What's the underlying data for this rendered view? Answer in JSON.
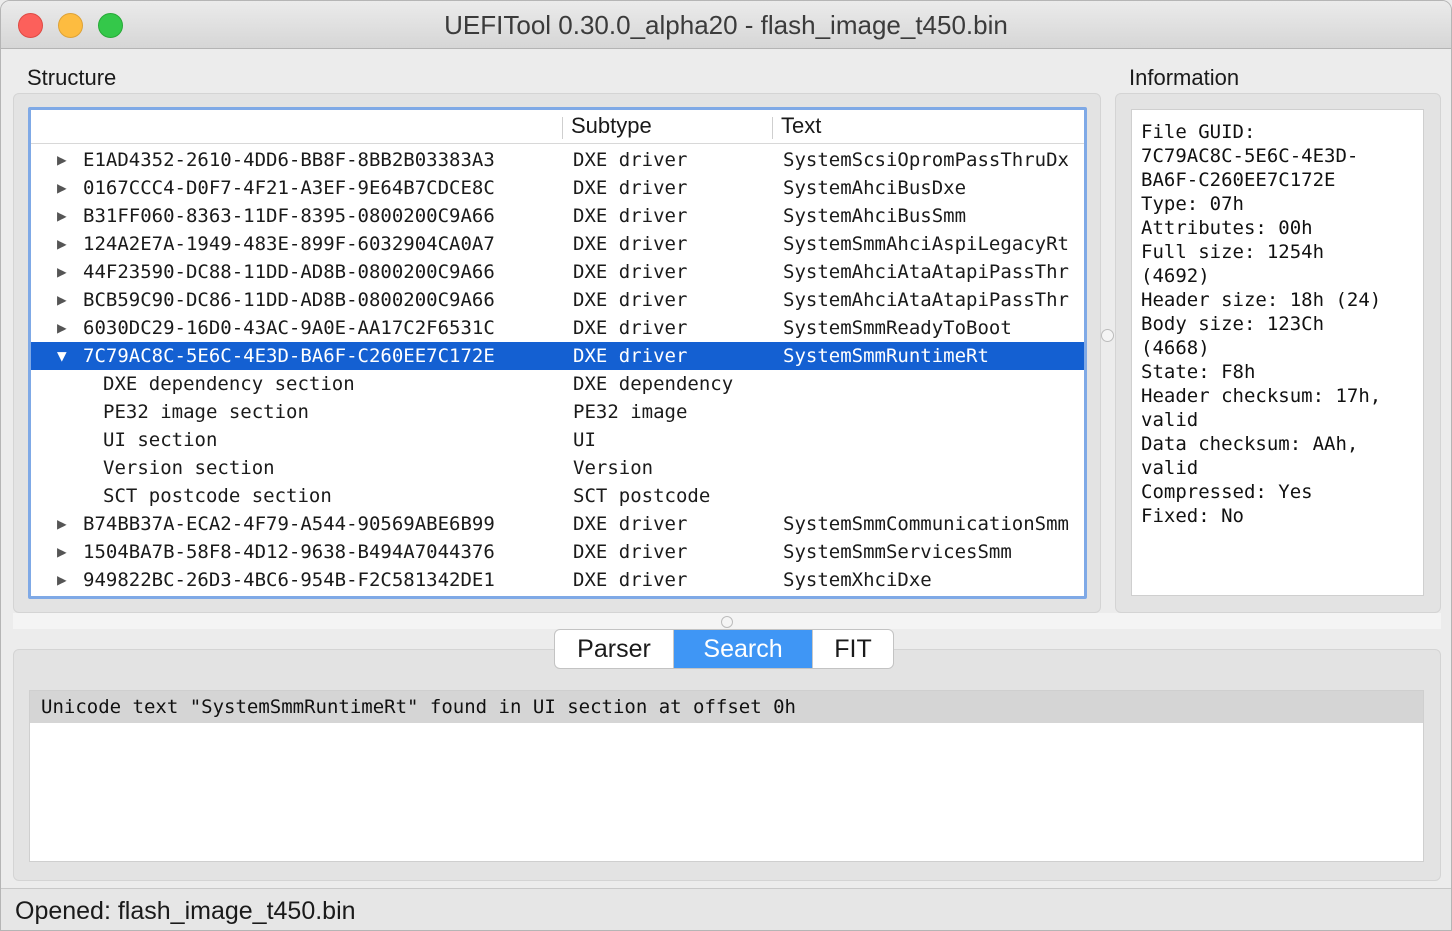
{
  "window": {
    "title": "UEFITool 0.30.0_alpha20 - flash_image_t450.bin"
  },
  "structure": {
    "label": "Structure",
    "columns": {
      "name": "",
      "subtype": "Subtype",
      "text": "Text"
    },
    "rows": [
      {
        "arrow": "▶",
        "name": "E1AD4352-2610-4DD6-BB8F-8BB2B03383A3",
        "subtype": "DXE driver",
        "text": "SystemScsiOpromPassThruDx"
      },
      {
        "arrow": "▶",
        "name": "0167CCC4-D0F7-4F21-A3EF-9E64B7CDCE8C",
        "subtype": "DXE driver",
        "text": "SystemAhciBusDxe"
      },
      {
        "arrow": "▶",
        "name": "B31FF060-8363-11DF-8395-0800200C9A66",
        "subtype": "DXE driver",
        "text": "SystemAhciBusSmm"
      },
      {
        "arrow": "▶",
        "name": "124A2E7A-1949-483E-899F-6032904CA0A7",
        "subtype": "DXE driver",
        "text": "SystemSmmAhciAspiLegacyRt"
      },
      {
        "arrow": "▶",
        "name": "44F23590-DC88-11DD-AD8B-0800200C9A66",
        "subtype": "DXE driver",
        "text": "SystemAhciAtaAtapiPassThr"
      },
      {
        "arrow": "▶",
        "name": "BCB59C90-DC86-11DD-AD8B-0800200C9A66",
        "subtype": "DXE driver",
        "text": "SystemAhciAtaAtapiPassThr"
      },
      {
        "arrow": "▶",
        "name": "6030DC29-16D0-43AC-9A0E-AA17C2F6531C",
        "subtype": "DXE driver",
        "text": "SystemSmmReadyToBoot"
      },
      {
        "arrow": "▼",
        "name": "7C79AC8C-5E6C-4E3D-BA6F-C260EE7C172E",
        "subtype": "DXE driver",
        "text": "SystemSmmRuntimeRt",
        "selected": true
      },
      {
        "arrow": "",
        "name": "DXE dependency section",
        "subtype": "DXE dependency",
        "text": "",
        "child": true
      },
      {
        "arrow": "",
        "name": "PE32 image section",
        "subtype": "PE32 image",
        "text": "",
        "child": true
      },
      {
        "arrow": "",
        "name": "UI section",
        "subtype": "UI",
        "text": "",
        "child": true
      },
      {
        "arrow": "",
        "name": "Version section",
        "subtype": "Version",
        "text": "",
        "child": true
      },
      {
        "arrow": "",
        "name": "SCT postcode section",
        "subtype": "SCT postcode",
        "text": "",
        "child": true
      },
      {
        "arrow": "▶",
        "name": "B74BB37A-ECA2-4F79-A544-90569ABE6B99",
        "subtype": "DXE driver",
        "text": "SystemSmmCommunicationSmm"
      },
      {
        "arrow": "▶",
        "name": "1504BA7B-58F8-4D12-9638-B494A7044376",
        "subtype": "DXE driver",
        "text": "SystemSmmServicesSmm"
      },
      {
        "arrow": "▶",
        "name": "949822BC-26D3-4BC6-954B-F2C581342DE1",
        "subtype": "DXE driver",
        "text": "SystemXhciDxe"
      }
    ]
  },
  "information": {
    "label": "Information",
    "text": "File GUID:\n7C79AC8C-5E6C-4E3D-\nBA6F-C260EE7C172E\nType: 07h\nAttributes: 00h\nFull size: 1254h\n(4692)\nHeader size: 18h (24)\nBody size: 123Ch\n(4668)\nState: F8h\nHeader checksum: 17h,\nvalid\nData checksum: AAh,\nvalid\nCompressed: Yes\nFixed: No"
  },
  "tabs": {
    "parser": "Parser",
    "search": "Search",
    "fit": "FIT",
    "active": "search"
  },
  "messages": [
    "Unicode text \"SystemSmmRuntimeRt\" found in UI section at offset 0h"
  ],
  "status": {
    "text": "Opened: flash_image_t450.bin"
  },
  "colors": {
    "selection": "#1460d2",
    "active_tab": "#3f96f5",
    "tree_focus_border": "#7fa9e6"
  }
}
